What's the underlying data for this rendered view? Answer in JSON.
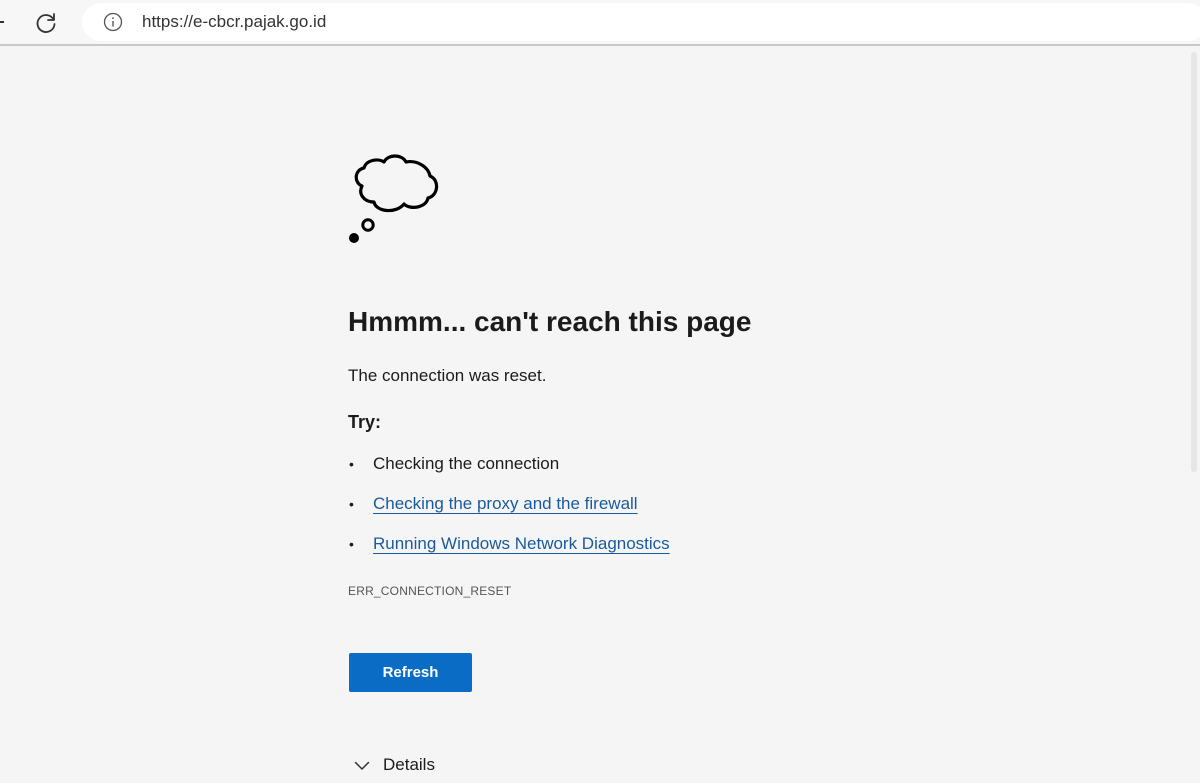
{
  "browser": {
    "url": "https://e-cbcr.pajak.go.id",
    "icons": {
      "refresh": "refresh-icon",
      "info": "info-icon"
    }
  },
  "error_page": {
    "illustration": "thought-cloud-icon",
    "title": "Hmmm... can't reach this page",
    "message": "The connection was reset.",
    "try_label": "Try:",
    "suggestions": [
      {
        "text": "Checking the connection",
        "is_link": false
      },
      {
        "text": "Checking the proxy and the firewall",
        "is_link": true
      },
      {
        "text": "Running Windows Network Diagnostics",
        "is_link": true
      }
    ],
    "error_code": "ERR_CONNECTION_RESET",
    "refresh_label": "Refresh",
    "details_label": "Details"
  },
  "colors": {
    "page_background": "#f5f5f5",
    "link": "#1a5a9c",
    "primary_button": "#0a6cc4"
  }
}
